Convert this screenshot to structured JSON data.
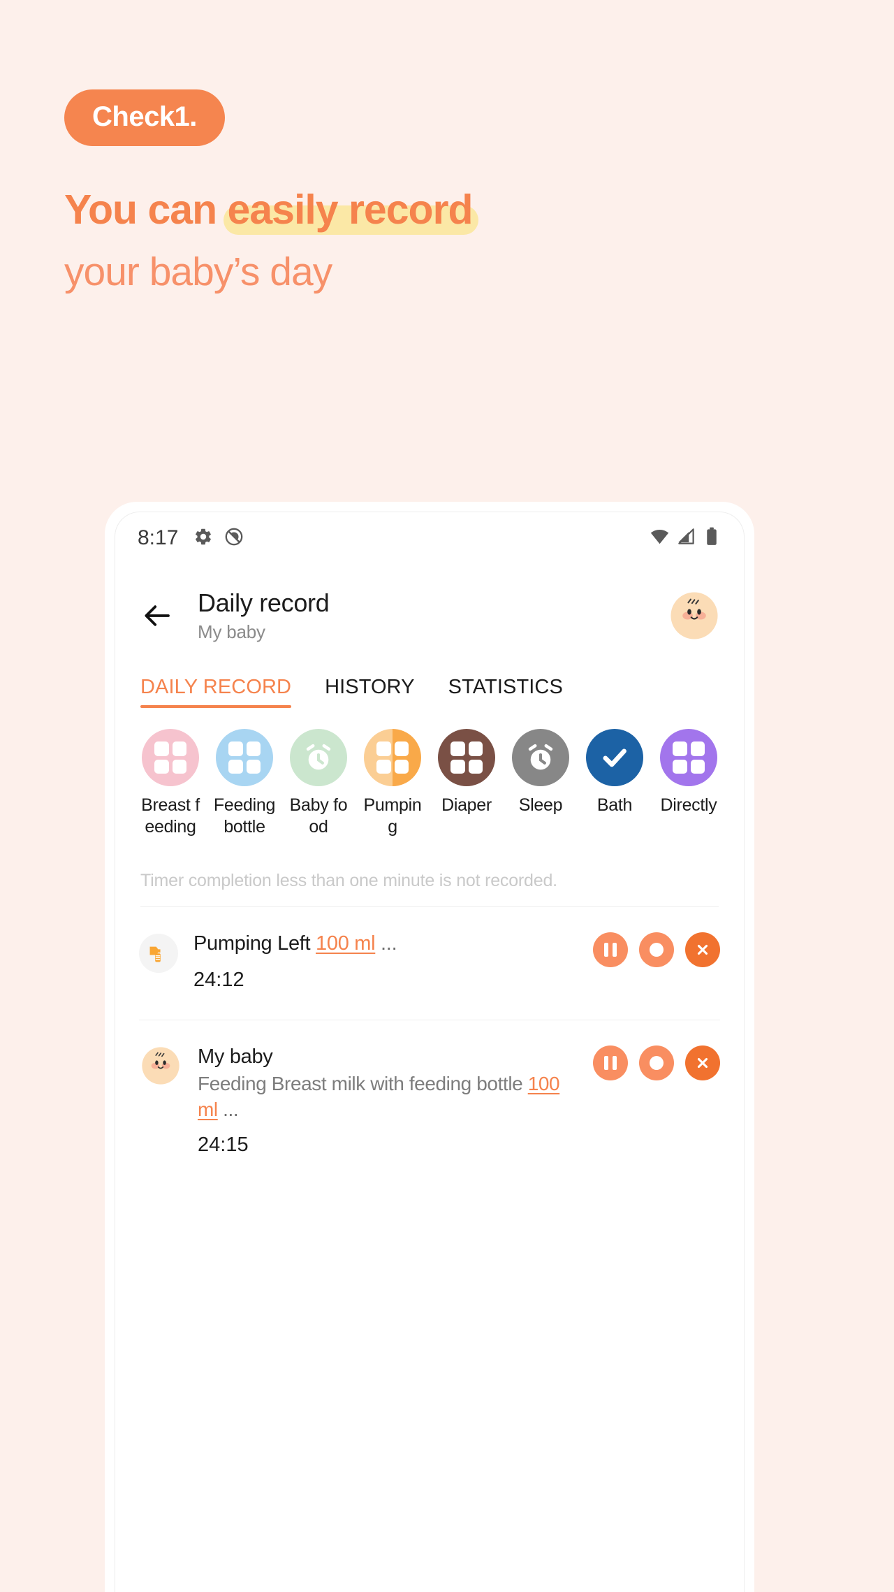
{
  "promo": {
    "badge": "Check1.",
    "headline_part1": "You can ",
    "headline_highlight": "easily record",
    "subline": "your baby’s day",
    "accent_color": "#F5834D",
    "badge_bg": "#F5854F",
    "highlight_color": "#FBE8A6",
    "page_bg": "#FDF0EB"
  },
  "statusbar": {
    "time": "8:17",
    "left_icons": [
      "gear-icon",
      "no-silent-icon"
    ],
    "right_icons": [
      "wifi-icon",
      "cellular-signal-icon",
      "battery-icon"
    ]
  },
  "appbar": {
    "back_icon": "back-arrow-icon",
    "title": "Daily record",
    "subtitle": "My baby",
    "avatar": "baby-avatar"
  },
  "tabs": [
    {
      "label": "DAILY RECORD",
      "active": true
    },
    {
      "label": "HISTORY",
      "active": false
    },
    {
      "label": "STATISTICS",
      "active": false
    }
  ],
  "categories": [
    {
      "label": "Breast feeding",
      "color": "#F6C3CE",
      "glyph": "grid-icon"
    },
    {
      "label": "Feeding bottle",
      "color": "#A8D5F2",
      "glyph": "grid-icon"
    },
    {
      "label": "Baby food",
      "color": "#CBE6CE",
      "glyph": "alarm-clock-icon"
    },
    {
      "label": "Pumping",
      "color": "#F9A949",
      "color2": "#FBCE94",
      "glyph": "grid-icon"
    },
    {
      "label": "Diaper",
      "color": "#7A5045",
      "glyph": "grid-icon"
    },
    {
      "label": "Sleep",
      "color": "#878787",
      "glyph": "alarm-clock-icon"
    },
    {
      "label": "Bath",
      "color": "#1C62A5",
      "glyph": "check-icon"
    },
    {
      "label": "Directly",
      "color": "#A275EC",
      "glyph": "grid-icon"
    }
  ],
  "note": "Timer completion less than one minute is not recorded.",
  "records": [
    {
      "icon": "breast-pump-icon",
      "title_prefix": "Pumping Left ",
      "amount": "100 ml",
      "suffix": " ...",
      "desc": "",
      "time": "24:12",
      "actions": [
        {
          "name": "pause-button",
          "glyph": "pause-icon"
        },
        {
          "name": "stop-button",
          "glyph": "stop-icon"
        },
        {
          "name": "cancel-button",
          "glyph": "close-icon"
        }
      ]
    },
    {
      "icon": "baby-avatar",
      "title_prefix": "My baby",
      "amount": "100 ml",
      "suffix": " ...",
      "desc_prefix": "Feeding Breast milk with feeding bottle ",
      "time": "24:15",
      "actions": [
        {
          "name": "pause-button",
          "glyph": "pause-icon"
        },
        {
          "name": "stop-button",
          "glyph": "stop-icon"
        },
        {
          "name": "cancel-button",
          "glyph": "close-icon"
        }
      ]
    }
  ]
}
